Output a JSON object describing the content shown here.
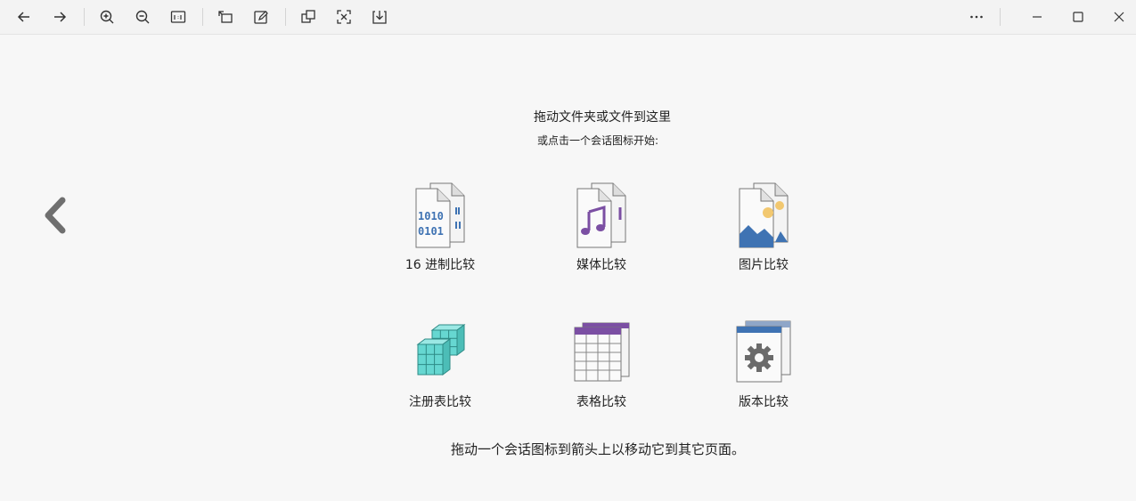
{
  "toolbar": {
    "buttons": [
      {
        "name": "back-icon"
      },
      {
        "name": "forward-icon"
      },
      {
        "name": "zoom-in-icon"
      },
      {
        "name": "zoom-out-icon"
      },
      {
        "name": "actual-size-icon"
      },
      {
        "name": "rotate-icon"
      },
      {
        "name": "edit-icon"
      },
      {
        "name": "copy-icon"
      },
      {
        "name": "fit-icon"
      },
      {
        "name": "download-icon"
      },
      {
        "name": "more-icon"
      }
    ],
    "window": [
      "minimize-icon",
      "maximize-icon",
      "close-icon"
    ]
  },
  "main": {
    "hint_title": "拖动文件夹或文件到这里",
    "hint_sub": "或点击一个会话图标开始:",
    "bottom_hint": "拖动一个会话图标到箭头上以移动它到其它页面。",
    "sessions": [
      {
        "label": "16 进制比较",
        "icon": "hex-compare-icon",
        "digits_top": "1010",
        "digits_bottom": "0101"
      },
      {
        "label": "媒体比较",
        "icon": "media-compare-icon"
      },
      {
        "label": "图片比较",
        "icon": "picture-compare-icon"
      },
      {
        "label": "注册表比较",
        "icon": "registry-compare-icon"
      },
      {
        "label": "表格比较",
        "icon": "table-compare-icon"
      },
      {
        "label": "版本比较",
        "icon": "version-compare-icon"
      }
    ]
  },
  "colors": {
    "accent_purple": "#7b4fa3",
    "accent_blue": "#3f73b3",
    "accent_teal": "#66d7d1"
  }
}
